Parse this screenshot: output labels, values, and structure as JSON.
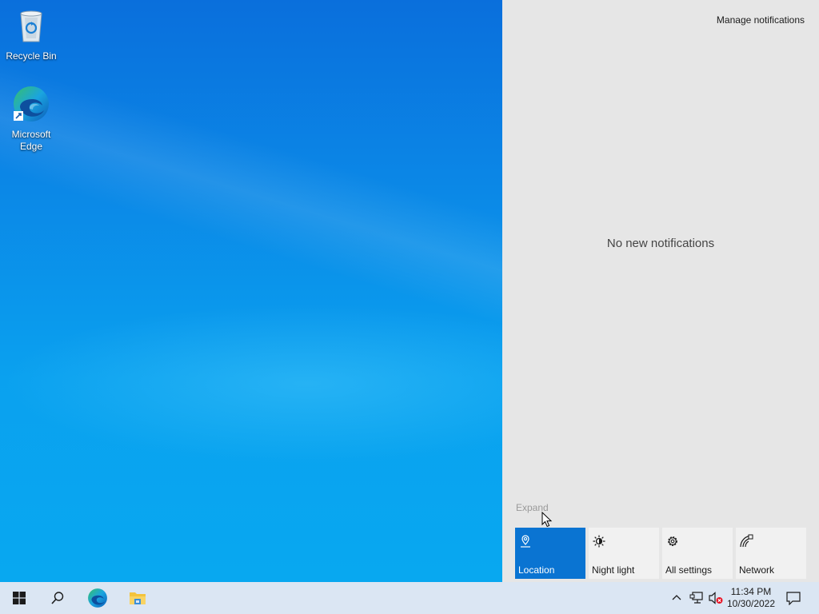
{
  "desktop": {
    "icons": [
      {
        "label": "Recycle Bin",
        "icon": "recycle-bin-icon"
      },
      {
        "label": "Microsoft\nEdge",
        "label_line1": "Microsoft",
        "label_line2": "Edge",
        "icon": "edge-icon"
      }
    ]
  },
  "action_center": {
    "manage_link": "Manage notifications",
    "empty_message": "No new notifications",
    "expand_link": "Expand",
    "quick_actions": [
      {
        "label": "Location",
        "icon": "location-icon",
        "active": true
      },
      {
        "label": "Night light",
        "icon": "night-light-icon",
        "active": false
      },
      {
        "label": "All settings",
        "icon": "gear-icon",
        "active": false
      },
      {
        "label": "Network",
        "icon": "network-icon",
        "active": false
      }
    ]
  },
  "taskbar": {
    "start_icon": "windows-start-icon",
    "search_icon": "search-icon",
    "pinned": [
      "edge-icon",
      "file-explorer-icon"
    ],
    "tray": {
      "icons": [
        "chevron-up-icon",
        "network-wired-icon",
        "volume-muted-icon",
        "notification-icon"
      ],
      "time": "11:34 PM",
      "date": "10/30/2022"
    }
  },
  "colors": {
    "accent": "#0a74d2",
    "action_center_bg": "#e6e6e6",
    "taskbar_bg": "#dbe6f3"
  }
}
